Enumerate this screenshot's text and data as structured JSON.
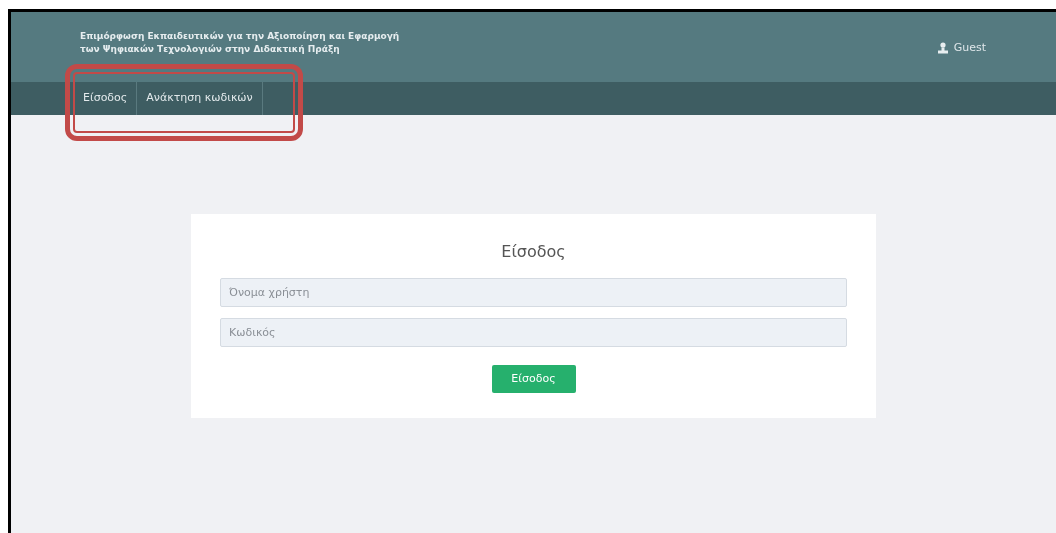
{
  "header": {
    "title_lines": [
      "Επιμόρφωση Εκπαιδευτικών για την Αξιοποίηση και Εφαρμογή",
      "των Ψηφιακών Τεχνολογιών στην Διδακτική Πράξη"
    ],
    "user": "Guest"
  },
  "nav": {
    "items": [
      {
        "label": "Είσοδος"
      },
      {
        "label": "Ανάκτηση κωδικών"
      }
    ]
  },
  "login": {
    "title": "Είσοδος",
    "fields": [
      {
        "placeholder": "Όνομα χρήστη"
      },
      {
        "placeholder": "Κωδικός"
      }
    ],
    "button": "Είσοδος"
  }
}
